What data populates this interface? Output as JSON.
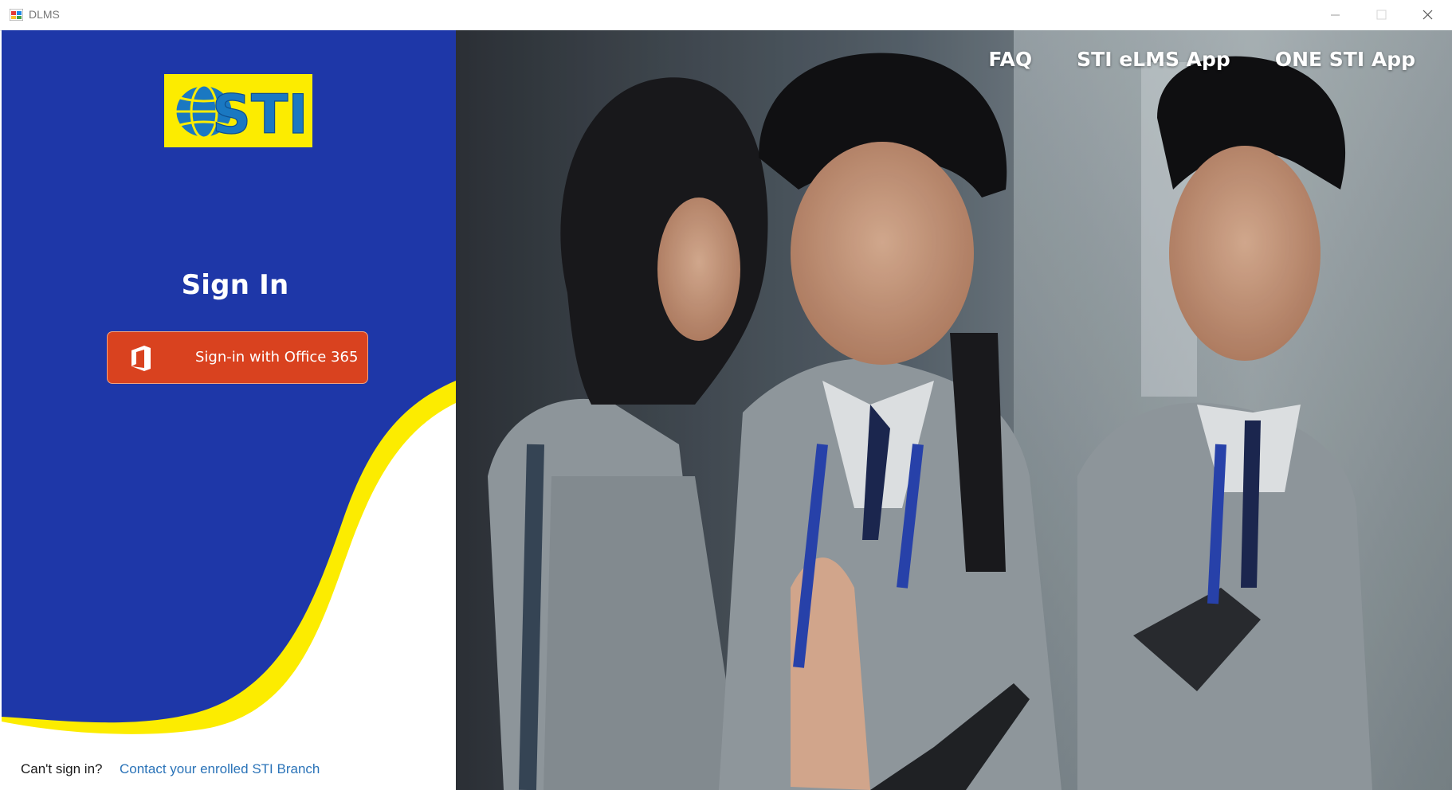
{
  "window": {
    "title": "DLMS"
  },
  "brand": {
    "logo_text": "STI",
    "colors": {
      "blue": "#1e37a8",
      "yellow": "#fcec00",
      "office_orange": "#d9421f",
      "link_blue": "#2a73b8"
    }
  },
  "signin": {
    "title": "Sign In",
    "office_button_label": "Sign-in with Office 365",
    "office_icon": "office-365-icon"
  },
  "footer": {
    "prompt": "Can't sign in?",
    "link": "Contact your enrolled STI Branch"
  },
  "nav": {
    "faq": "FAQ",
    "elms_app": "STI eLMS App",
    "one_sti_app": "ONE STI App"
  }
}
